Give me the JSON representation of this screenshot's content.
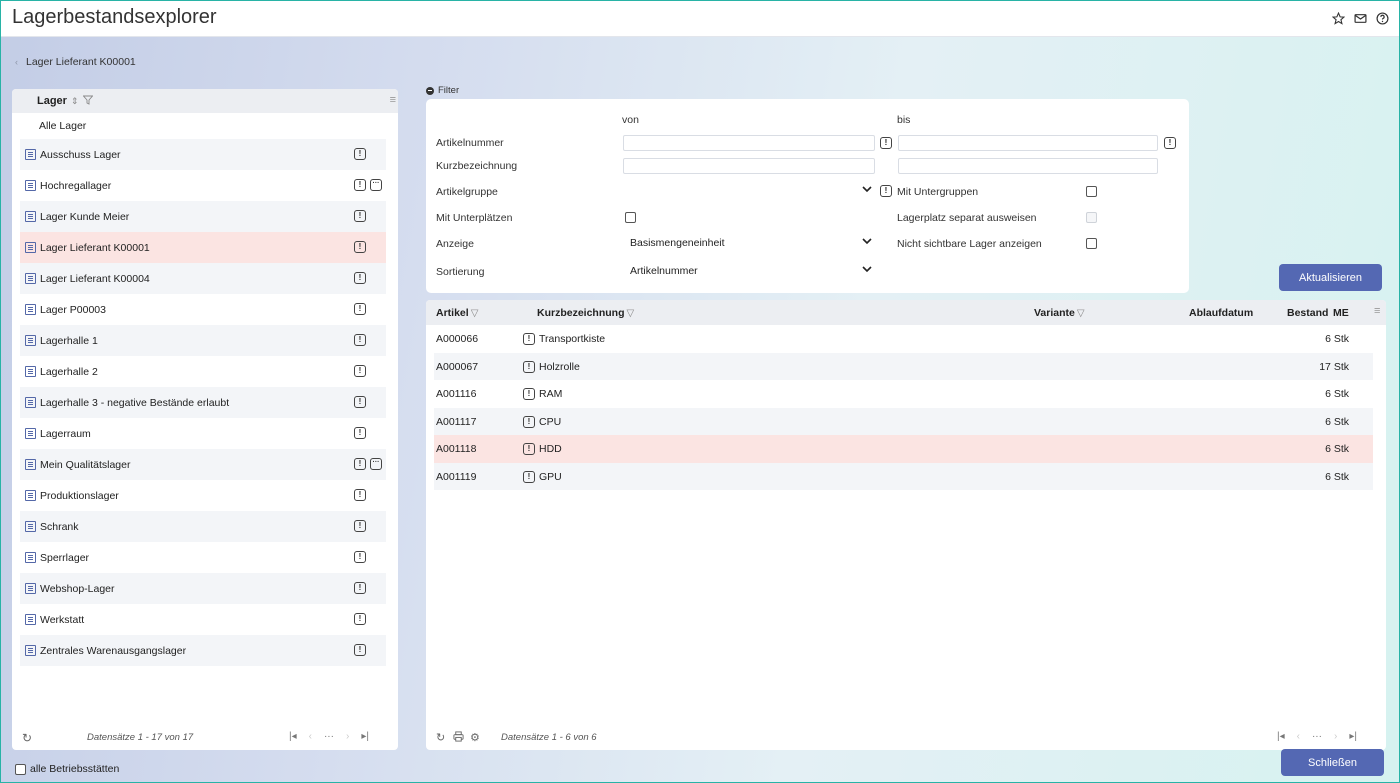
{
  "app": {
    "title": "Lagerbestandsexplorer"
  },
  "breadcrumb": {
    "label": "Lager Lieferant K00001"
  },
  "left": {
    "header": "Lager",
    "all_label": "Alle Lager",
    "rows": [
      {
        "label": "Ausschuss Lager",
        "extra": false,
        "selected": false
      },
      {
        "label": "Hochregallager",
        "extra": true,
        "selected": false
      },
      {
        "label": "Lager Kunde Meier",
        "extra": false,
        "selected": false
      },
      {
        "label": "Lager Lieferant K00001",
        "extra": false,
        "selected": true
      },
      {
        "label": "Lager Lieferant K00004",
        "extra": false,
        "selected": false
      },
      {
        "label": "Lager P00003",
        "extra": false,
        "selected": false
      },
      {
        "label": "Lagerhalle 1",
        "extra": false,
        "selected": false
      },
      {
        "label": "Lagerhalle 2",
        "extra": false,
        "selected": false
      },
      {
        "label": "Lagerhalle 3 - negative Bestände erlaubt",
        "extra": false,
        "selected": false
      },
      {
        "label": "Lagerraum",
        "extra": false,
        "selected": false
      },
      {
        "label": "Mein Qualitätslager",
        "extra": true,
        "selected": false
      },
      {
        "label": "Produktionslager",
        "extra": false,
        "selected": false
      },
      {
        "label": "Schrank",
        "extra": false,
        "selected": false
      },
      {
        "label": "Sperrlager",
        "extra": false,
        "selected": false
      },
      {
        "label": "Webshop-Lager",
        "extra": false,
        "selected": false
      },
      {
        "label": "Werkstatt",
        "extra": false,
        "selected": false
      },
      {
        "label": "Zentrales Warenausgangslager",
        "extra": false,
        "selected": false
      }
    ],
    "records": "Datensätze 1 - 17 von 17"
  },
  "filter": {
    "toggle_label": "Filter",
    "von": "von",
    "bis": "bis",
    "artikelnummer": "Artikelnummer",
    "kurzbezeichnung": "Kurzbezeichnung",
    "artikelgruppe": "Artikelgruppe",
    "mit_untergruppen": "Mit Untergruppen",
    "mit_unterplaetzen": "Mit Unterplätzen",
    "lagerplatz_separat": "Lagerplatz separat ausweisen",
    "anzeige": "Anzeige",
    "anzeige_value": "Basismengeneinheit",
    "nicht_sichtbare": "Nicht sichtbare Lager anzeigen",
    "sortierung": "Sortierung",
    "sortierung_value": "Artikelnummer",
    "refresh_button": "Aktualisieren"
  },
  "results": {
    "columns": {
      "artikel": "Artikel",
      "kurzbezeichnung": "Kurzbezeichnung",
      "variante": "Variante",
      "ablaufdatum": "Ablaufdatum",
      "bestand": "Bestand",
      "me": "ME"
    },
    "rows": [
      {
        "artikel": "A000066",
        "name": "Transportkiste",
        "bestand": "6 Stk",
        "selected": false
      },
      {
        "artikel": "A000067",
        "name": "Holzrolle",
        "bestand": "17 Stk",
        "selected": false
      },
      {
        "artikel": "A001116",
        "name": "RAM",
        "bestand": "6 Stk",
        "selected": false
      },
      {
        "artikel": "A001117",
        "name": "CPU",
        "bestand": "6 Stk",
        "selected": false
      },
      {
        "artikel": "A001118",
        "name": "HDD",
        "bestand": "6 Stk",
        "selected": true
      },
      {
        "artikel": "A001119",
        "name": "GPU",
        "bestand": "6 Stk",
        "selected": false
      }
    ],
    "records": "Datensätze 1 - 6 von 6"
  },
  "footer": {
    "alle_betriebsstaetten": "alle Betriebsstätten",
    "close_button": "Schließen"
  },
  "icons": {
    "badge_glyph": "!",
    "more_glyph": "···",
    "accent_color": "#5468b3",
    "selected_row_color": "#fbe4e2"
  }
}
